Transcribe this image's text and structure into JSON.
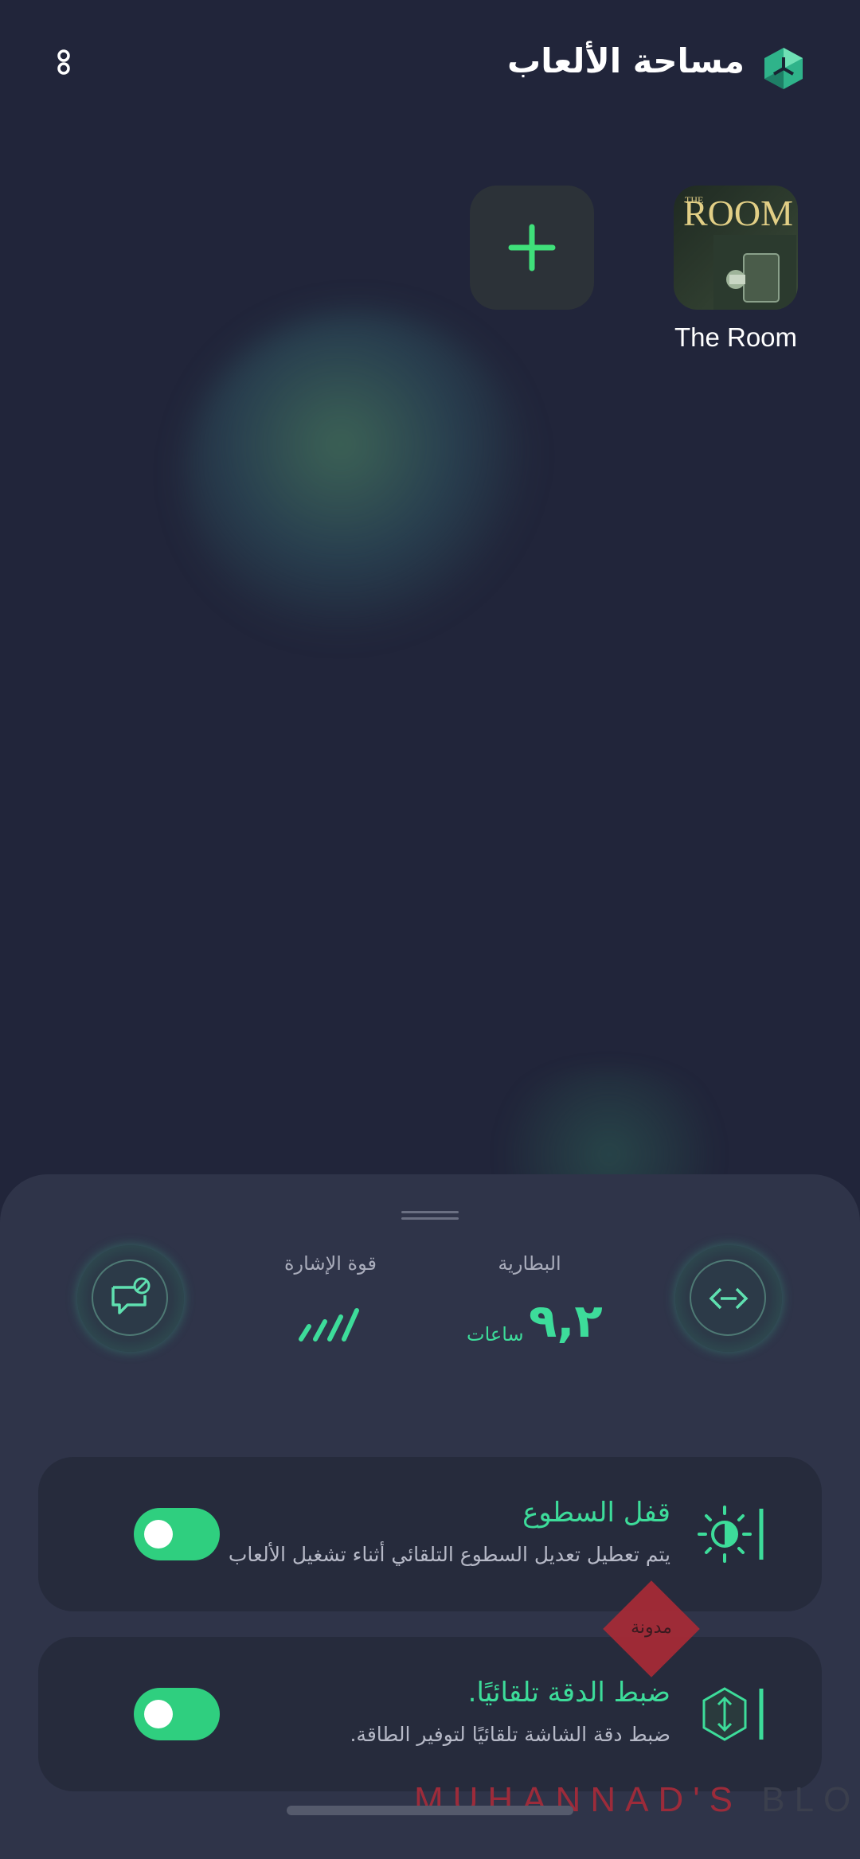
{
  "header": {
    "title": "مساحة الألعاب",
    "logo_icon": "game-space-logo-icon",
    "menu_icon": "more-vertical-icon"
  },
  "games": [
    {
      "name": "The Room",
      "icon_text": "ROOM",
      "icon_prefix": "THE"
    }
  ],
  "add_game": {
    "icon": "plus-icon"
  },
  "panel": {
    "battery": {
      "label": "البطارية",
      "value": "٩,٢",
      "unit": "ساعات"
    },
    "signal": {
      "label": "قوة الإشارة",
      "icon": "signal-bars-icon"
    },
    "left_button_icon": "message-block-icon",
    "right_button_icon": "code-arrows-icon"
  },
  "settings": [
    {
      "title": "قفل السطوع",
      "subtitle": "يتم تعطيل تعديل السطوع التلقائي أثناء تشغيل الألعاب",
      "icon": "brightness-icon",
      "enabled": true
    },
    {
      "title": "ضبط الدقة تلقائيًا.",
      "subtitle": "ضبط دقة الشاشة تلقائيًا لتوفير الطاقة.",
      "icon": "resolution-icon",
      "enabled": true
    }
  ],
  "watermark": {
    "part1": "MUHANNAD'S",
    "part2": "BLOG",
    "badge": "مدونة"
  },
  "colors": {
    "accent": "#3ddc9a",
    "toggle": "#2fcf7f",
    "background": "#21253a",
    "sheet": "#2f3449"
  }
}
